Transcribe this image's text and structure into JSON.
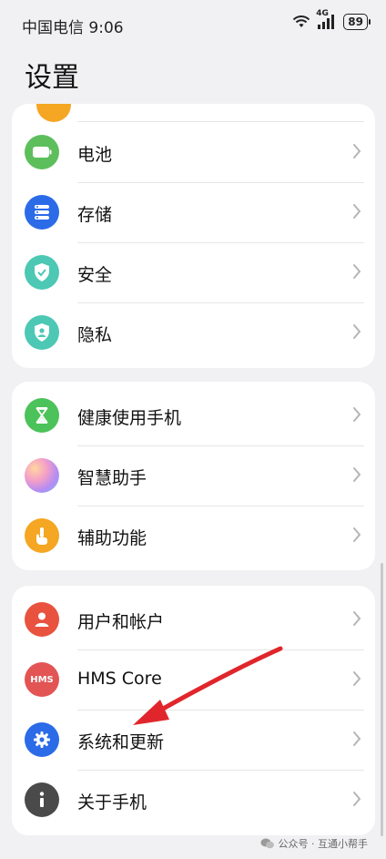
{
  "status_bar": {
    "carrier_time": "中国电信 9:06",
    "network": "4G",
    "battery": "89"
  },
  "page": {
    "title": "设置"
  },
  "groups": [
    {
      "items": [
        {
          "label": "电池",
          "icon": "battery-icon",
          "color": "#5cbf5c"
        },
        {
          "label": "存储",
          "icon": "storage-icon",
          "color": "#2b6be8"
        },
        {
          "label": "安全",
          "icon": "shield-icon",
          "color": "#4cc8b4"
        },
        {
          "label": "隐私",
          "icon": "privacy-icon",
          "color": "#4cc8b4"
        }
      ]
    },
    {
      "items": [
        {
          "label": "健康使用手机",
          "icon": "hourglass-icon",
          "color": "#4cc25a"
        },
        {
          "label": "智慧助手",
          "icon": "assistant-orb-icon",
          "color": "#c69bf0"
        },
        {
          "label": "辅助功能",
          "icon": "hand-icon",
          "color": "#f5a623"
        }
      ]
    },
    {
      "items": [
        {
          "label": "用户和帐户",
          "icon": "user-icon",
          "color": "#e8523f"
        },
        {
          "label": "HMS Core",
          "icon": "hms-icon",
          "color": "#e35454",
          "icon_text": "HMS"
        },
        {
          "label": "系统和更新",
          "icon": "gear-icon",
          "color": "#2b6be8"
        },
        {
          "label": "关于手机",
          "icon": "info-icon",
          "color": "#4a4a4a"
        }
      ]
    }
  ],
  "annotation": {
    "type": "arrow",
    "color": "#e0262c",
    "points_to": "系统和更新"
  },
  "watermark": {
    "text": "公众号 · 互通小帮手"
  }
}
